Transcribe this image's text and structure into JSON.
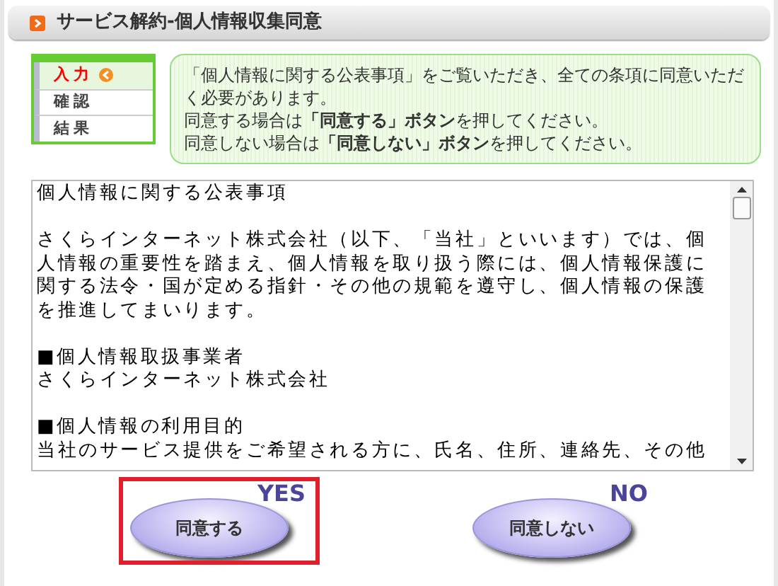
{
  "page_title": "サービス解約-個人情報収集同意",
  "steps": [
    {
      "label": "入力",
      "selected": true
    },
    {
      "label": "確認",
      "selected": false
    },
    {
      "label": "結果",
      "selected": false
    }
  ],
  "notice": [
    "「個人情報に関する公表事項」をご覧いただき、全ての条項に同意いただく必要があります。",
    "同意する場合は**「同意する」ボタン**を押してください。",
    "同意しない場合は**「同意しない」ボタン**を押してください。"
  ],
  "terms": [
    {
      "kind": "heading",
      "text": "個人情報に関する公表事項"
    },
    {
      "kind": "paragraph",
      "text": "さくらインターネット株式会社（以下、「当社」といいます）では、個人情報の重要性を踏まえ、個人情報を取り扱う際には、個人情報保護に関する法令・国が定める指針・その他の規範を遵守し、個人情報の保護を推進してまいります。"
    },
    {
      "kind": "heading",
      "text": "■個人情報取扱事業者"
    },
    {
      "kind": "line",
      "text": "さくらインターネット株式会社"
    },
    {
      "kind": "heading",
      "text": "■個人情報の利用目的"
    },
    {
      "kind": "line",
      "text": "当社のサービス提供をご希望される方に、氏名、住所、連絡先、その他"
    }
  ],
  "buttons": [
    {
      "label": "同意する",
      "badge": "YES",
      "focused": true
    },
    {
      "label": "同意しない",
      "badge": "NO",
      "focused": false
    }
  ]
}
